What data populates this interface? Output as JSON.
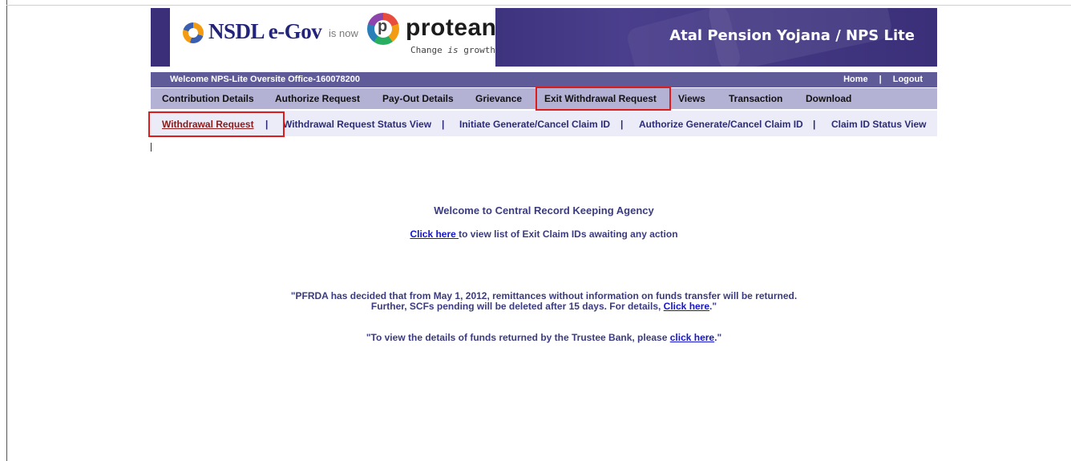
{
  "header": {
    "nsdl_logo": "NSDL e-Gov",
    "is_now": "is now",
    "protean_logo": "protean",
    "protean_tagline_pre": "Change ",
    "protean_tagline_em": "is",
    "protean_tagline_post": " growth",
    "title": "Atal Pension Yojana / NPS Lite"
  },
  "welcome_bar": {
    "welcome_text": "Welcome NPS-Lite Oversite Office-160078200",
    "home": "Home",
    "separator": "|",
    "logout": "Logout"
  },
  "main_menu": {
    "items": [
      {
        "label": "Contribution Details"
      },
      {
        "label": "Authorize Request"
      },
      {
        "label": "Pay-Out Details"
      },
      {
        "label": "Grievance"
      },
      {
        "label": "Exit Withdrawal Request",
        "highlighted": true
      },
      {
        "label": "Views"
      },
      {
        "label": "Transaction"
      },
      {
        "label": "Download"
      }
    ]
  },
  "sub_menu": {
    "separator": "|",
    "items": [
      {
        "label": "Withdrawal Request",
        "active": true
      },
      {
        "label": "Withdrawal Request Status View"
      },
      {
        "label": "Initiate Generate/Cancel Claim ID"
      },
      {
        "label": "Authorize Generate/Cancel Claim ID"
      },
      {
        "label": "Claim ID Status View"
      }
    ]
  },
  "content": {
    "welcome_title": "Welcome to Central Record Keeping Agency",
    "click_here_link": "Click here ",
    "click_here_suffix": "to view list of Exit Claim IDs awaiting any action",
    "notice_line1": "\"PFRDA has decided that from May 1, 2012, remittances without information on funds transfer will be returned.",
    "notice_line2_prefix": "Further, SCFs pending will be deleted after 15 days. For details, ",
    "notice_line2_link": "Click here",
    "notice_line2_suffix": ".\"",
    "trustee_prefix": "\"To view the details of funds returned by the Trustee Bank, please ",
    "trustee_link": "click here",
    "trustee_suffix": ".\""
  },
  "colors": {
    "header_bg": "#3a2f78",
    "welcome_bar_bg": "#5f5b99",
    "main_menu_bg": "#b3b1d4",
    "sub_menu_bg": "#ececf8",
    "highlight_box": "#e01b1b",
    "link": "#1414d6"
  }
}
